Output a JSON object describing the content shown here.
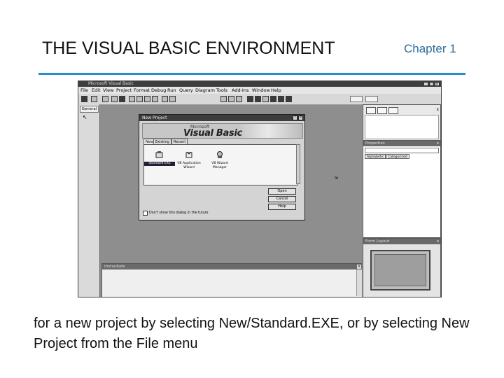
{
  "slide": {
    "title": "THE VISUAL BASIC ENVIRONMENT",
    "chapter": "Chapter 1",
    "caption": "for a new project by selecting New/Standard.EXE, or by selecting New Project from the File menu",
    "accent_color": "#2e8bc9"
  },
  "ide": {
    "window_title": "Microsoft Visual Basic",
    "menu": [
      "File",
      "Edit",
      "View",
      "Project",
      "Format",
      "Debug",
      "Run",
      "Query",
      "Diagram",
      "Tools",
      "Add-Ins",
      "Window",
      "Help"
    ],
    "toolbox": {
      "header": "General",
      "pointer_icon": "pointer-icon"
    },
    "immediate": {
      "title": "Immediate"
    },
    "project_explorer": {
      "close": "x"
    },
    "properties": {
      "title": "Properties",
      "close": "x",
      "tabs": [
        "Alphabetic",
        "Categorized"
      ]
    },
    "form_layout": {
      "title": "Form Layout",
      "close": "x"
    }
  },
  "dialog": {
    "title": "New Project",
    "banner_small": "Microsoft",
    "banner_large": "Visual Basic",
    "tabs": [
      "New",
      "Existing",
      "Recent"
    ],
    "items": [
      {
        "label": "Standard EXE",
        "selected": true
      },
      {
        "label": "VB Application Wizard",
        "selected": false
      },
      {
        "label": "VB Wizard Manager",
        "selected": false
      }
    ],
    "buttons": {
      "open": "Open",
      "cancel": "Cancel",
      "help": "Help"
    },
    "checkbox": "Don't show this dialog in the future"
  }
}
